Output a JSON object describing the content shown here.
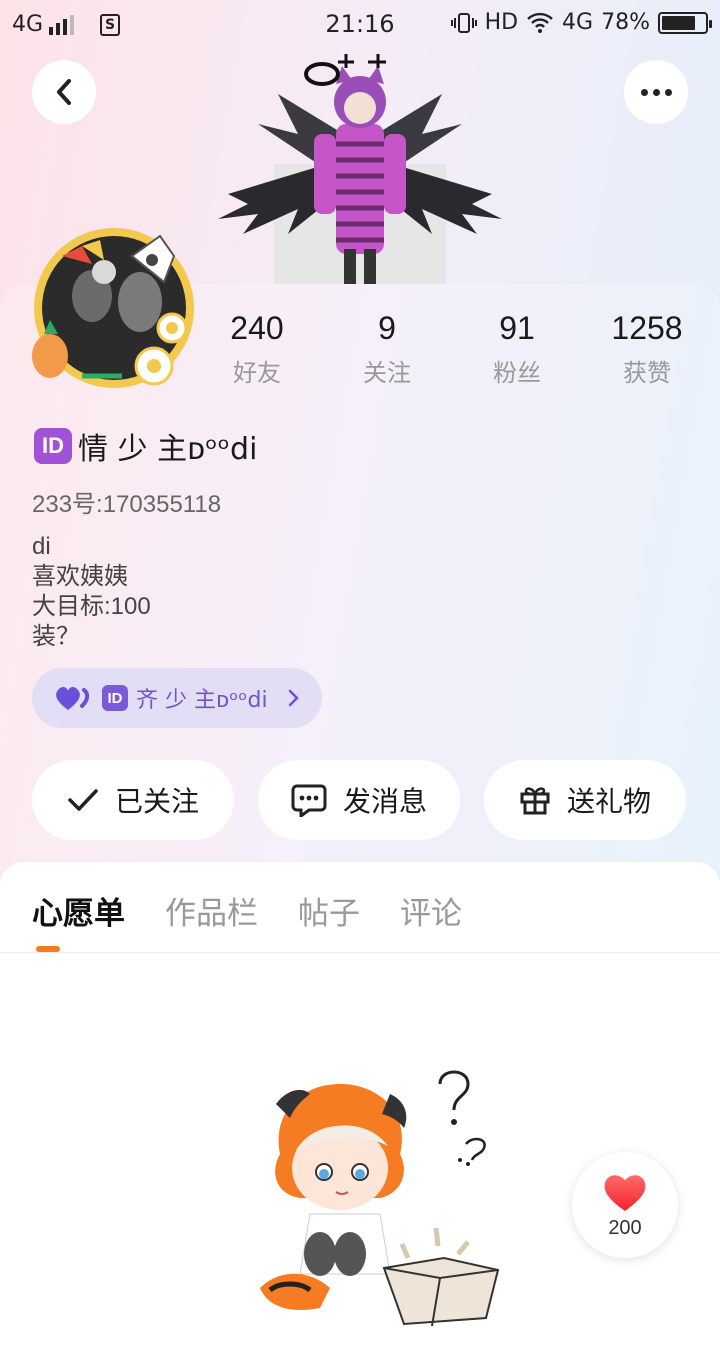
{
  "status_bar": {
    "network": "4G",
    "time": "21:16",
    "hd": "HD",
    "net_right": "4G",
    "battery": "78%",
    "battery_level": 0.78
  },
  "header": {
    "back_icon": "chevron-left-icon",
    "more_icon": "more-dots-icon"
  },
  "profile": {
    "stats": [
      {
        "value": "240",
        "label": "好友"
      },
      {
        "value": "9",
        "label": "关注"
      },
      {
        "value": "91",
        "label": "粉丝"
      },
      {
        "value": "1258",
        "label": "获赞"
      }
    ],
    "id_badge": "ID",
    "name": "情 少 主ᴅᵒᵒdi",
    "account_id": "233号:170355118",
    "bio_lines": [
      "di",
      "喜欢姨姨",
      "大目标:100",
      "装？"
    ],
    "fan_chip": {
      "id_badge": "ID",
      "label": "齐 少 主ᴅᵒᵒdi"
    }
  },
  "actions": {
    "follow_label": "已关注",
    "message_label": "发消息",
    "gift_label": "送礼物"
  },
  "tabs": [
    {
      "label": "心愿单",
      "active": true
    },
    {
      "label": "作品栏",
      "active": false
    },
    {
      "label": "帖子",
      "active": false
    },
    {
      "label": "评论",
      "active": false
    }
  ],
  "like": {
    "count": "200"
  },
  "colors": {
    "accent_orange": "#f57c22",
    "id_badge_purple": "#a052d8",
    "chip_text": "#6f55c8",
    "heart_red": "#ff4d4f"
  }
}
